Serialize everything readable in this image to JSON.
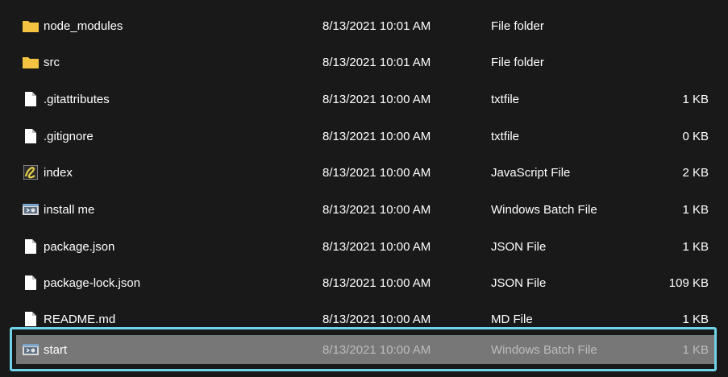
{
  "files": [
    {
      "name": "node_modules",
      "date": "8/13/2021 10:01 AM",
      "type": "File folder",
      "size": "",
      "icon": "folder-icon"
    },
    {
      "name": "src",
      "date": "8/13/2021 10:01 AM",
      "type": "File folder",
      "size": "",
      "icon": "folder-icon"
    },
    {
      "name": ".gitattributes",
      "date": "8/13/2021 10:00 AM",
      "type": "txtfile",
      "size": "1 KB",
      "icon": "file-icon"
    },
    {
      "name": ".gitignore",
      "date": "8/13/2021 10:00 AM",
      "type": "txtfile",
      "size": "0 KB",
      "icon": "file-icon"
    },
    {
      "name": "index",
      "date": "8/13/2021 10:00 AM",
      "type": "JavaScript File",
      "size": "2 KB",
      "icon": "javascript-file-icon"
    },
    {
      "name": "install me",
      "date": "8/13/2021 10:00 AM",
      "type": "Windows Batch File",
      "size": "1 KB",
      "icon": "batch-file-icon"
    },
    {
      "name": "package.json",
      "date": "8/13/2021 10:00 AM",
      "type": "JSON File",
      "size": "1 KB",
      "icon": "file-icon"
    },
    {
      "name": "package-lock.json",
      "date": "8/13/2021 10:00 AM",
      "type": "JSON File",
      "size": "109 KB",
      "icon": "file-icon"
    },
    {
      "name": "README.md",
      "date": "8/13/2021 10:00 AM",
      "type": "MD File",
      "size": "1 KB",
      "icon": "file-icon"
    },
    {
      "name": "start",
      "date": "8/13/2021 10:00 AM",
      "type": "Windows Batch File",
      "size": "1 KB",
      "icon": "batch-file-icon",
      "selected": true
    }
  ],
  "colors": {
    "background": "#191919",
    "selected_row": "#777777",
    "selection_frame": "#6fd4ea",
    "folder": "#f4c342"
  }
}
